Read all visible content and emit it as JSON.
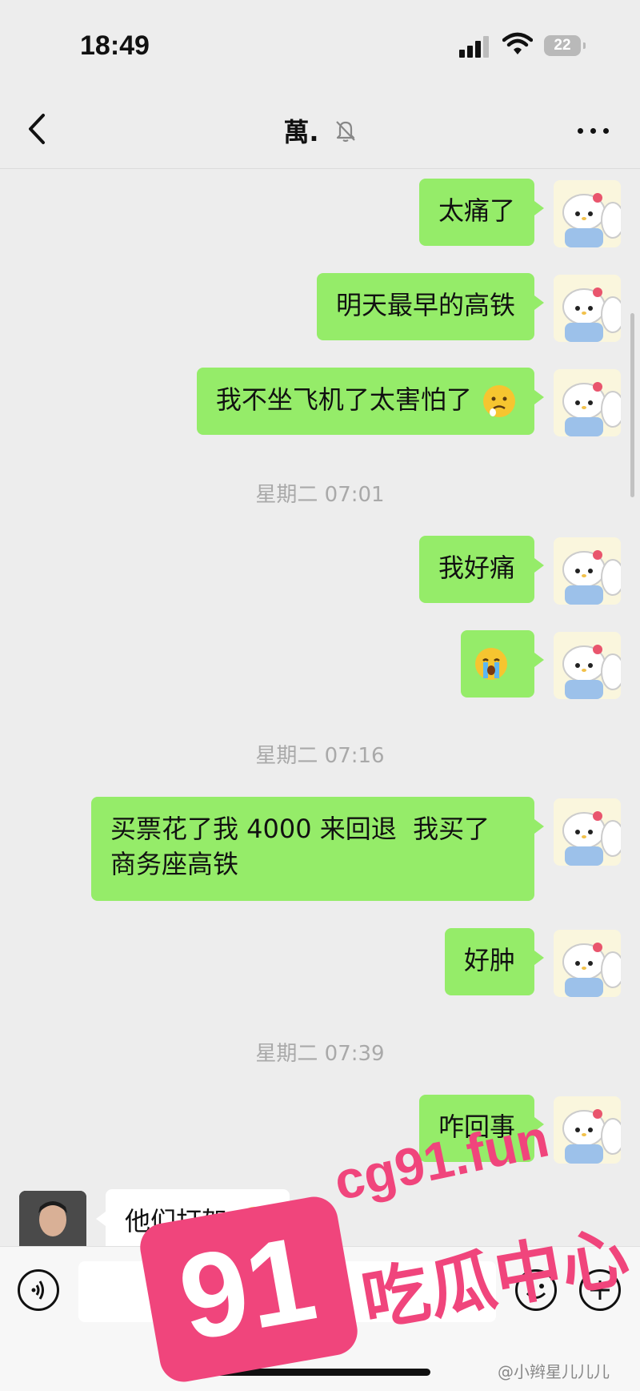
{
  "status": {
    "time": "18:49",
    "battery": "22"
  },
  "header": {
    "title": "萬."
  },
  "messages": {
    "m1": "太痛了",
    "m2": "明天最早的高铁",
    "m3": "我不坐飞机了太害怕了",
    "ts1": "星期二 07:01",
    "m4": "我好痛",
    "ts2": "星期二 07:16",
    "m6a": "买票花了我 4000 来回退  我买了",
    "m6b": "商务座高铁",
    "m7": "好肿",
    "ts3": "星期二 07:39",
    "m8": "咋回事",
    "m9": "他们打架"
  },
  "watermark": {
    "site": "cg91.fun",
    "badge": "91",
    "slogan": "吃瓜中心"
  },
  "footer": {
    "credit": "@小辫星儿儿儿"
  },
  "colors": {
    "bubble_self": "#95ec69",
    "bubble_other": "#ffffff",
    "background": "#ededed",
    "watermark": "#f0457c"
  },
  "icons": [
    "back-icon",
    "mute-bell-icon",
    "more-icon",
    "voice-icon",
    "emoji-icon",
    "plus-icon"
  ]
}
